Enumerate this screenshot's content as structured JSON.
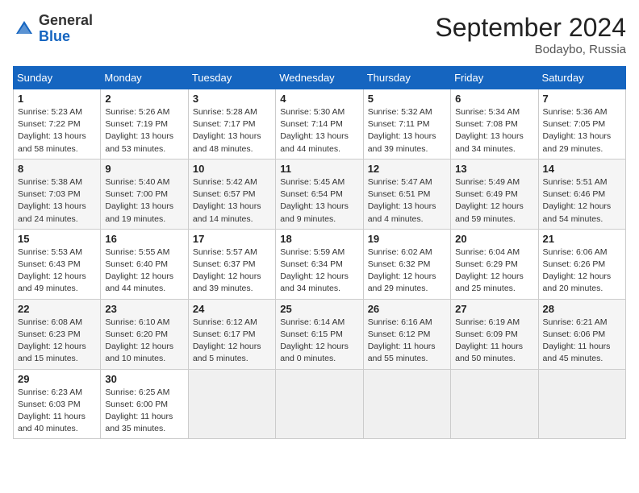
{
  "header": {
    "logo_general": "General",
    "logo_blue": "Blue",
    "month_title": "September 2024",
    "location": "Bodaybo, Russia"
  },
  "weekdays": [
    "Sunday",
    "Monday",
    "Tuesday",
    "Wednesday",
    "Thursday",
    "Friday",
    "Saturday"
  ],
  "weeks": [
    [
      {
        "day": "1",
        "sunrise": "5:23 AM",
        "sunset": "7:22 PM",
        "daylight": "13 hours and 58 minutes."
      },
      {
        "day": "2",
        "sunrise": "5:26 AM",
        "sunset": "7:19 PM",
        "daylight": "13 hours and 53 minutes."
      },
      {
        "day": "3",
        "sunrise": "5:28 AM",
        "sunset": "7:17 PM",
        "daylight": "13 hours and 48 minutes."
      },
      {
        "day": "4",
        "sunrise": "5:30 AM",
        "sunset": "7:14 PM",
        "daylight": "13 hours and 44 minutes."
      },
      {
        "day": "5",
        "sunrise": "5:32 AM",
        "sunset": "7:11 PM",
        "daylight": "13 hours and 39 minutes."
      },
      {
        "day": "6",
        "sunrise": "5:34 AM",
        "sunset": "7:08 PM",
        "daylight": "13 hours and 34 minutes."
      },
      {
        "day": "7",
        "sunrise": "5:36 AM",
        "sunset": "7:05 PM",
        "daylight": "13 hours and 29 minutes."
      }
    ],
    [
      {
        "day": "8",
        "sunrise": "5:38 AM",
        "sunset": "7:03 PM",
        "daylight": "13 hours and 24 minutes."
      },
      {
        "day": "9",
        "sunrise": "5:40 AM",
        "sunset": "7:00 PM",
        "daylight": "13 hours and 19 minutes."
      },
      {
        "day": "10",
        "sunrise": "5:42 AM",
        "sunset": "6:57 PM",
        "daylight": "13 hours and 14 minutes."
      },
      {
        "day": "11",
        "sunrise": "5:45 AM",
        "sunset": "6:54 PM",
        "daylight": "13 hours and 9 minutes."
      },
      {
        "day": "12",
        "sunrise": "5:47 AM",
        "sunset": "6:51 PM",
        "daylight": "13 hours and 4 minutes."
      },
      {
        "day": "13",
        "sunrise": "5:49 AM",
        "sunset": "6:49 PM",
        "daylight": "12 hours and 59 minutes."
      },
      {
        "day": "14",
        "sunrise": "5:51 AM",
        "sunset": "6:46 PM",
        "daylight": "12 hours and 54 minutes."
      }
    ],
    [
      {
        "day": "15",
        "sunrise": "5:53 AM",
        "sunset": "6:43 PM",
        "daylight": "12 hours and 49 minutes."
      },
      {
        "day": "16",
        "sunrise": "5:55 AM",
        "sunset": "6:40 PM",
        "daylight": "12 hours and 44 minutes."
      },
      {
        "day": "17",
        "sunrise": "5:57 AM",
        "sunset": "6:37 PM",
        "daylight": "12 hours and 39 minutes."
      },
      {
        "day": "18",
        "sunrise": "5:59 AM",
        "sunset": "6:34 PM",
        "daylight": "12 hours and 34 minutes."
      },
      {
        "day": "19",
        "sunrise": "6:02 AM",
        "sunset": "6:32 PM",
        "daylight": "12 hours and 29 minutes."
      },
      {
        "day": "20",
        "sunrise": "6:04 AM",
        "sunset": "6:29 PM",
        "daylight": "12 hours and 25 minutes."
      },
      {
        "day": "21",
        "sunrise": "6:06 AM",
        "sunset": "6:26 PM",
        "daylight": "12 hours and 20 minutes."
      }
    ],
    [
      {
        "day": "22",
        "sunrise": "6:08 AM",
        "sunset": "6:23 PM",
        "daylight": "12 hours and 15 minutes."
      },
      {
        "day": "23",
        "sunrise": "6:10 AM",
        "sunset": "6:20 PM",
        "daylight": "12 hours and 10 minutes."
      },
      {
        "day": "24",
        "sunrise": "6:12 AM",
        "sunset": "6:17 PM",
        "daylight": "12 hours and 5 minutes."
      },
      {
        "day": "25",
        "sunrise": "6:14 AM",
        "sunset": "6:15 PM",
        "daylight": "12 hours and 0 minutes."
      },
      {
        "day": "26",
        "sunrise": "6:16 AM",
        "sunset": "6:12 PM",
        "daylight": "11 hours and 55 minutes."
      },
      {
        "day": "27",
        "sunrise": "6:19 AM",
        "sunset": "6:09 PM",
        "daylight": "11 hours and 50 minutes."
      },
      {
        "day": "28",
        "sunrise": "6:21 AM",
        "sunset": "6:06 PM",
        "daylight": "11 hours and 45 minutes."
      }
    ],
    [
      {
        "day": "29",
        "sunrise": "6:23 AM",
        "sunset": "6:03 PM",
        "daylight": "11 hours and 40 minutes."
      },
      {
        "day": "30",
        "sunrise": "6:25 AM",
        "sunset": "6:00 PM",
        "daylight": "11 hours and 35 minutes."
      },
      null,
      null,
      null,
      null,
      null
    ]
  ]
}
